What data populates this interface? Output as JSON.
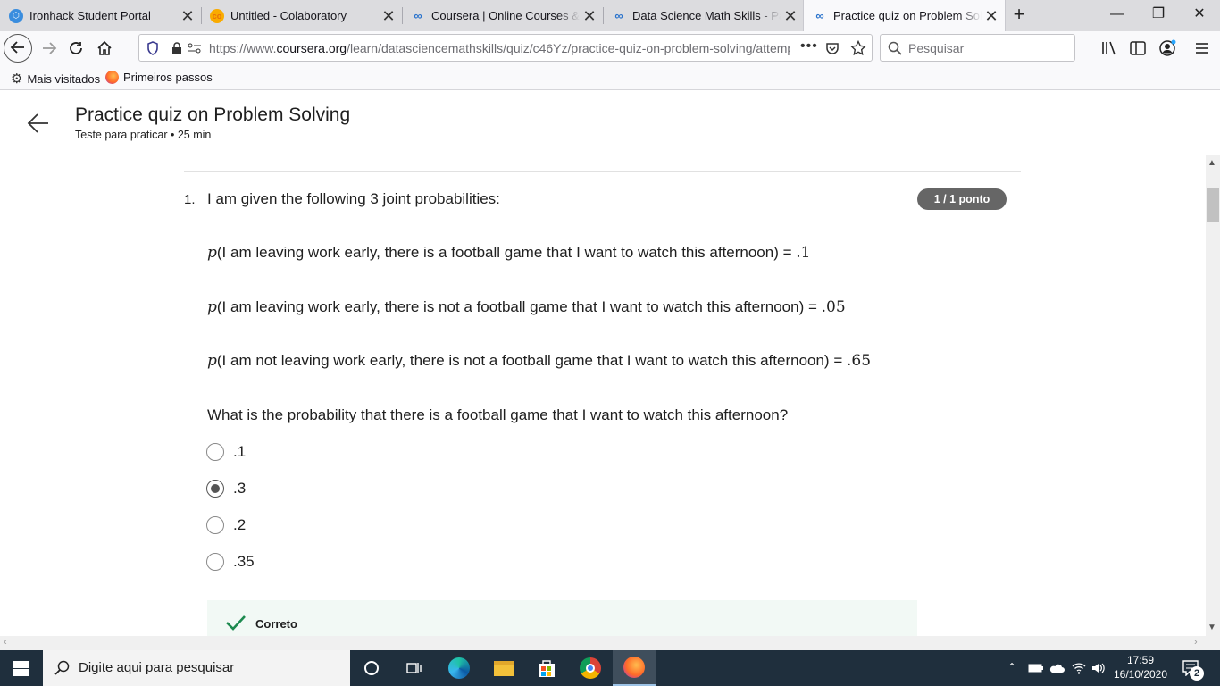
{
  "browser": {
    "tabs": [
      {
        "title": "Ironhack Student Portal",
        "icon": "ironhack-icon",
        "color": "#3a8dde"
      },
      {
        "title": "Untitled - Colaboratory",
        "icon": "colab-icon",
        "color": "#f9ab00"
      },
      {
        "title": "Coursera | Online Courses & Cr",
        "icon": "coursera-icon",
        "color": "#2a73cc"
      },
      {
        "title": "Data Science Math Skills - Págin",
        "icon": "coursera-icon",
        "color": "#2a73cc"
      },
      {
        "title": "Practice quiz on Problem Solvin",
        "icon": "coursera-icon",
        "color": "#2a73cc",
        "active": true
      }
    ],
    "url_prefix": "https://www.",
    "url_domain": "coursera.org",
    "url_path": "/learn/datasciencemathskills/quiz/c46Yz/practice-quiz-on-problem-solving/attemp",
    "search_placeholder": "Pesquisar",
    "bookmarks": [
      {
        "label": "Mais visitados",
        "icon": "gear-icon"
      },
      {
        "label": "Primeiros passos",
        "icon": "firefox-icon"
      }
    ]
  },
  "quiz": {
    "title": "Practice quiz on Problem Solving",
    "subtitle": "Teste para praticar • 25 min",
    "question_number": "1.",
    "question_intro": "I am given the following 3 joint probabilities:",
    "score": "1 / 1 ponto",
    "probabilities": [
      {
        "p": "p",
        "text": "(I am leaving work early, there is a football game that I want to watch this afternoon) = ",
        "value": ".1"
      },
      {
        "p": "p",
        "text": "(I am leaving work early, there is not a football game that I want to watch this afternoon) = ",
        "value": ".05"
      },
      {
        "p": "p",
        "text": "(I am not leaving work early, there is not a football game that I want to watch this afternoon) = ",
        "value": ".65"
      }
    ],
    "question": "What is the probability that there is a football game that I want to watch this afternoon?",
    "options": [
      {
        "label": ".1",
        "selected": false
      },
      {
        "label": ".3",
        "selected": true
      },
      {
        "label": ".2",
        "selected": false
      },
      {
        "label": ".35",
        "selected": false
      }
    ],
    "feedback": "Correto",
    "feedback_color": "#1d8a4f"
  },
  "taskbar": {
    "search_placeholder": "Digite aqui para pesquisar",
    "time": "17:59",
    "date": "16/10/2020",
    "notifications": "2"
  }
}
